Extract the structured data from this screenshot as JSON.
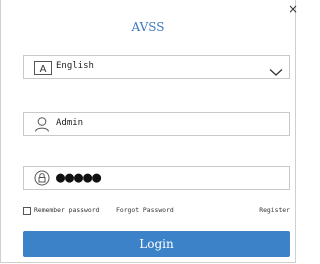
{
  "window": {
    "title": "AVSS",
    "close_glyph": "×"
  },
  "language": {
    "icon": "language-a-icon",
    "value": "English",
    "dropdown_icon": "chevron-down-icon"
  },
  "username": {
    "icon": "user-icon",
    "value": "Admin"
  },
  "password": {
    "icon": "lock-icon",
    "masked_value": "●●●●●"
  },
  "options": {
    "remember_label": "Remember password",
    "remember_checked": false,
    "forgot_label": "Forgot Password",
    "register_label": "Register"
  },
  "login_button": {
    "label": "Login"
  },
  "colors": {
    "accent": "#3b82c8",
    "title": "#3c77c2",
    "border": "#c9c9c9"
  }
}
